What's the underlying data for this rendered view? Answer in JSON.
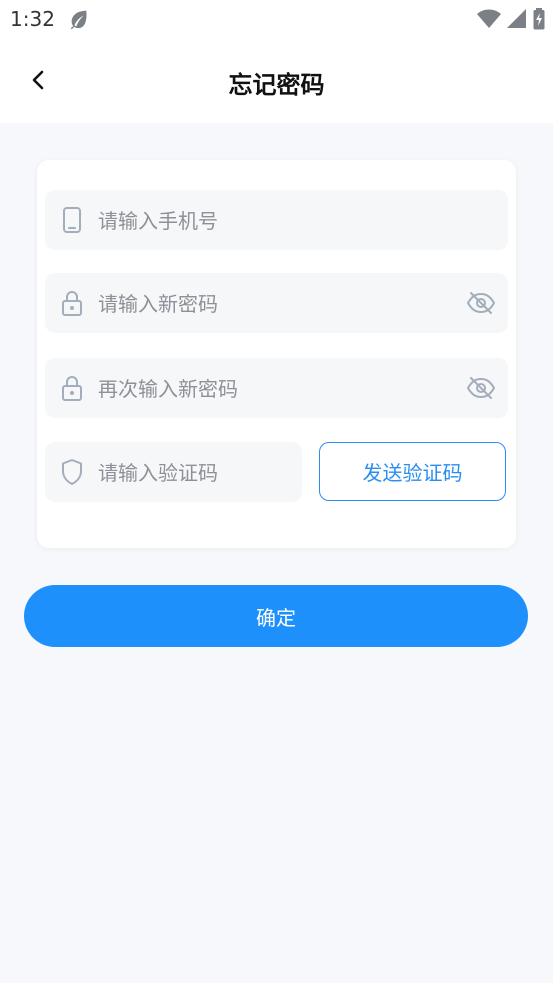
{
  "status_bar": {
    "time": "1:32"
  },
  "header": {
    "title": "忘记密码"
  },
  "form": {
    "phone_placeholder": "请输入手机号",
    "new_password_placeholder": "请输入新密码",
    "confirm_password_placeholder": "再次输入新密码",
    "code_placeholder": "请输入验证码",
    "send_code_label": "发送验证码"
  },
  "confirm_label": "确定",
  "colors": {
    "accent": "#1e90fb",
    "icon": "#a4adba",
    "field_bg": "#f6f7f9",
    "page_bg": "#f6f8fb"
  }
}
